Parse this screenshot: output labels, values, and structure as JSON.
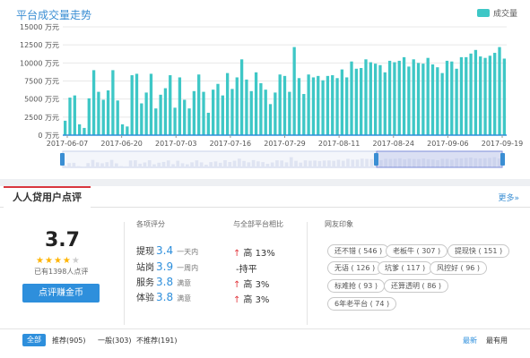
{
  "chart_card": {
    "title": "平台成交量走势",
    "legend_label": "成交量"
  },
  "chart_data": {
    "type": "bar",
    "title": "平台成交量走势",
    "series": [
      {
        "name": "成交量"
      }
    ],
    "ylim": [
      0,
      15000
    ],
    "ytick_labels": [
      "15000 万元",
      "12500 万元",
      "10000 万元",
      "7500 万元",
      "5000 万元",
      "2500 万元",
      "0 万元"
    ],
    "xtick_labels": [
      "2017-06-07",
      "2017-06-20",
      "2017-07-03",
      "2017-07-16",
      "2017-07-29",
      "2017-08-11",
      "2017-08-24",
      "2017-09-06",
      "2017-09-19"
    ],
    "values": [
      2000,
      5200,
      5500,
      1500,
      1000,
      5100,
      9000,
      6000,
      4900,
      6200,
      9000,
      4800,
      1500,
      1200,
      8300,
      8500,
      4400,
      5900,
      8500,
      3700,
      5600,
      6500,
      8300,
      3800,
      8000,
      4900,
      3700,
      6100,
      8400,
      6000,
      3100,
      6300,
      7100,
      5500,
      8600,
      6400,
      8000,
      10500,
      7700,
      6100,
      8700,
      7200,
      6300,
      4300,
      5900,
      8400,
      8200,
      6000,
      12200,
      7900,
      5700,
      8400,
      8000,
      8200,
      7600,
      8200,
      8300,
      7900,
      9100,
      8000,
      10200,
      9200,
      9300,
      10500,
      10100,
      9900,
      9700,
      8700,
      10300,
      10100,
      10300,
      10800,
      9500,
      10500,
      10000,
      9900,
      10700,
      9800,
      9400,
      8600,
      10300,
      10200,
      9200,
      10800,
      10800,
      11300,
      11800,
      10900,
      10700,
      11000,
      11400,
      12200,
      10600
    ],
    "grid": true
  },
  "review": {
    "tab_label": "人人贷用户点评",
    "more_label": "更多»",
    "score": "3.7",
    "stars_filled": 4,
    "stars_total": 5,
    "count_text": "已有1398人点评",
    "review_button_label": "点评赚金币",
    "ratings_header": "各项评分",
    "compare_header": "与全部平台相比",
    "tags_header": "网友印象",
    "ratings": [
      {
        "label": "提现",
        "score": "3.4",
        "desc": "一天内"
      },
      {
        "label": "站岗",
        "score": "3.9",
        "desc": "一周内"
      },
      {
        "label": "服务",
        "score": "3.8",
        "desc": "满意"
      },
      {
        "label": "体验",
        "score": "3.8",
        "desc": "满意"
      }
    ],
    "compare": [
      {
        "arrow": "↑",
        "text": "高 13%"
      },
      {
        "arrow": "",
        "text": "-持平"
      },
      {
        "arrow": "↑",
        "text": "高 3%"
      },
      {
        "arrow": "↑",
        "text": "高 3%"
      }
    ],
    "tags": [
      "还不错 ( 546 )",
      "老板牛 ( 307 )",
      "提现快 ( 151 )",
      "无语 ( 126 )",
      "坑爹 ( 117 )",
      "风控好 ( 96 )",
      "标难抢 ( 93 )",
      "还算透明 ( 86 )",
      "6年老平台 ( 74 )"
    ]
  },
  "filter": {
    "all_label": "全部",
    "items": [
      "推荐(905)",
      "一般(303)",
      "不推荐(191)"
    ],
    "sort_latest": "最新",
    "sort_useful": "最有用"
  },
  "colors": {
    "bar": "#3ec7c6",
    "accent_blue": "#2e8fdc",
    "star": "#ffb400",
    "up_arrow": "#e2383e"
  }
}
